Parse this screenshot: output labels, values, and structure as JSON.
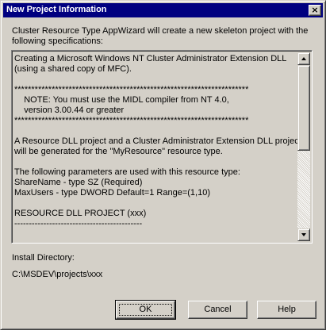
{
  "window": {
    "title": "New Project Information",
    "close_glyph": "×"
  },
  "intro": {
    "line1": "Cluster Resource Type AppWizard will create a new skeleton project with the",
    "line2": "following specifications:"
  },
  "spec_text": "Creating a Microsoft Windows NT Cluster Administrator Extension DLL\n(using a shared copy of MFC).\n\n*********************************************************************\n    NOTE: You must use the MIDL compiler from NT 4.0,\n    version 3.00.44 or greater\n*********************************************************************\n\nA Resource DLL project and a Cluster Administrator Extension DLL project\nwill be generated for the \"MyResource\" resource type.\n\nThe following parameters are used with this resource type:\nShareName - type SZ (Required)\nMaxUsers - type DWORD Default=1 Range=(1,10)\n\nRESOURCE DLL PROJECT (xxx)\n--------------------------------------------",
  "install": {
    "label": "Install Directory:",
    "path": "C:\\MSDEV\\projects\\xxx"
  },
  "buttons": {
    "ok": "OK",
    "cancel": "Cancel",
    "help": "Help"
  },
  "colors": {
    "titlebar": "#000080",
    "face": "#d4d0c8"
  }
}
